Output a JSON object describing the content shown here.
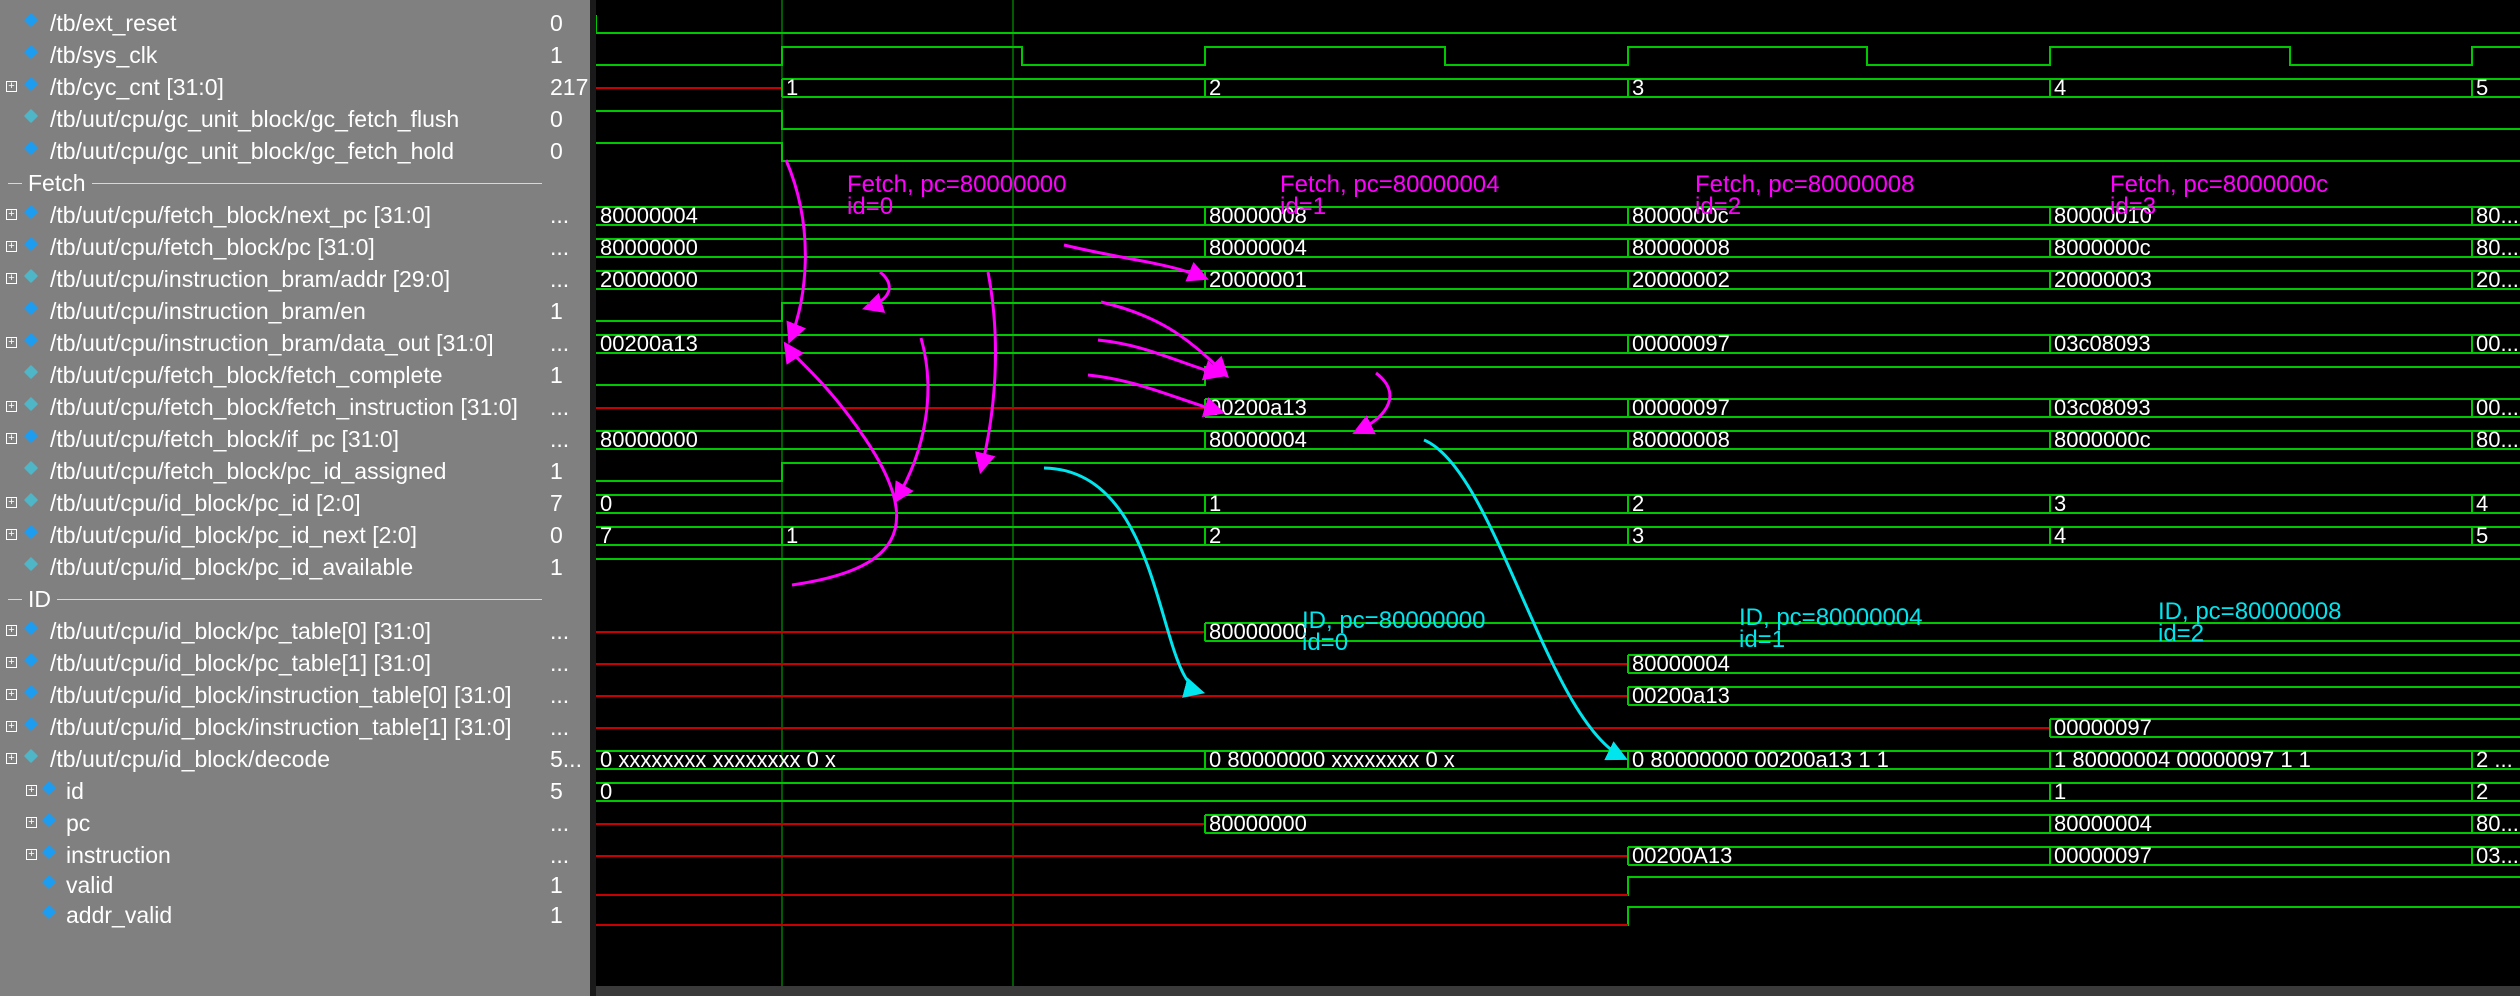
{
  "colors": {
    "trace": "#00c800",
    "undefined": "#c80000",
    "cursor": "#00b400",
    "fetch_note": "#ff00ff",
    "id_note": "#00e5ee",
    "value_text": "#ffffff"
  },
  "groups": {
    "fetch": "Fetch",
    "id": "ID"
  },
  "signals": [
    {
      "name": "/tb/ext_reset",
      "value": "0",
      "expandable": false,
      "child": false,
      "kind": "in"
    },
    {
      "name": "/tb/sys_clk",
      "value": "1",
      "expandable": false,
      "child": false,
      "kind": "in"
    },
    {
      "name": "/tb/cyc_cnt [31:0]",
      "value": "217",
      "expandable": true,
      "child": false,
      "kind": "in"
    },
    {
      "name": "/tb/uut/cpu/gc_unit_block/gc_fetch_flush",
      "value": "0",
      "expandable": false,
      "child": false,
      "kind": "out"
    },
    {
      "name": "/tb/uut/cpu/gc_unit_block/gc_fetch_hold",
      "value": "0",
      "expandable": false,
      "child": false,
      "kind": "in"
    },
    {
      "name": "/tb/uut/cpu/fetch_block/next_pc [31:0]",
      "value": "...",
      "expandable": true,
      "child": false,
      "kind": "in"
    },
    {
      "name": "/tb/uut/cpu/fetch_block/pc [31:0]",
      "value": "...",
      "expandable": true,
      "child": false,
      "kind": "in"
    },
    {
      "name": "/tb/uut/cpu/instruction_bram/addr [29:0]",
      "value": "...",
      "expandable": true,
      "child": false,
      "kind": "out"
    },
    {
      "name": "/tb/uut/cpu/instruction_bram/en",
      "value": "1",
      "expandable": false,
      "child": false,
      "kind": "in"
    },
    {
      "name": "/tb/uut/cpu/instruction_bram/data_out [31:0]",
      "value": "...",
      "expandable": true,
      "child": false,
      "kind": "in"
    },
    {
      "name": "/tb/uut/cpu/fetch_block/fetch_complete",
      "value": "1",
      "expandable": false,
      "child": false,
      "kind": "out"
    },
    {
      "name": "/tb/uut/cpu/fetch_block/fetch_instruction [31:0]",
      "value": "...",
      "expandable": true,
      "child": false,
      "kind": "out"
    },
    {
      "name": "/tb/uut/cpu/fetch_block/if_pc [31:0]",
      "value": "...",
      "expandable": true,
      "child": false,
      "kind": "in"
    },
    {
      "name": "/tb/uut/cpu/fetch_block/pc_id_assigned",
      "value": "1",
      "expandable": false,
      "child": false,
      "kind": "out"
    },
    {
      "name": "/tb/uut/cpu/id_block/pc_id [2:0]",
      "value": "7",
      "expandable": true,
      "child": false,
      "kind": "out"
    },
    {
      "name": "/tb/uut/cpu/id_block/pc_id_next [2:0]",
      "value": "0",
      "expandable": true,
      "child": false,
      "kind": "in"
    },
    {
      "name": "/tb/uut/cpu/id_block/pc_id_available",
      "value": "1",
      "expandable": false,
      "child": false,
      "kind": "out"
    },
    {
      "name": "/tb/uut/cpu/id_block/pc_table[0] [31:0]",
      "value": "...",
      "expandable": true,
      "child": false,
      "kind": "in"
    },
    {
      "name": "/tb/uut/cpu/id_block/pc_table[1] [31:0]",
      "value": "...",
      "expandable": true,
      "child": false,
      "kind": "in"
    },
    {
      "name": "/tb/uut/cpu/id_block/instruction_table[0] [31:0]",
      "value": "...",
      "expandable": true,
      "child": false,
      "kind": "in"
    },
    {
      "name": "/tb/uut/cpu/id_block/instruction_table[1] [31:0]",
      "value": "...",
      "expandable": true,
      "child": false,
      "kind": "in"
    },
    {
      "name": "/tb/uut/cpu/id_block/decode",
      "value": "5...",
      "expandable": true,
      "child": false,
      "kind": "out"
    },
    {
      "name": "id",
      "value": "5",
      "expandable": true,
      "child": true,
      "kind": "in"
    },
    {
      "name": "pc",
      "value": "...",
      "expandable": true,
      "child": true,
      "kind": "in"
    },
    {
      "name": "instruction",
      "value": "...",
      "expandable": true,
      "child": true,
      "kind": "in"
    },
    {
      "name": "valid",
      "value": "1",
      "expandable": false,
      "child": true,
      "kind": "in"
    },
    {
      "name": "addr_valid",
      "value": "1",
      "expandable": false,
      "child": true,
      "kind": "in"
    }
  ],
  "waves": {
    "cyc_cnt": [
      "1",
      "2",
      "3",
      "4",
      "5"
    ],
    "next_pc": [
      "80000004",
      "80000008",
      "8000000c",
      "80000010",
      "80..."
    ],
    "pc": [
      "80000000",
      "80000004",
      "80000008",
      "8000000c",
      "80..."
    ],
    "bram_addr": [
      "20000000",
      "20000001",
      "20000002",
      "20000003",
      "20..."
    ],
    "bram_data_out": [
      "00200a13",
      "00000097",
      "03c08093",
      "00..."
    ],
    "fetch_instruction": [
      "00200a13",
      "00000097",
      "03c08093",
      "00..."
    ],
    "if_pc": [
      "80000000",
      "80000004",
      "80000008",
      "8000000c",
      "80..."
    ],
    "pc_id": [
      "0",
      "1",
      "2",
      "3",
      "4"
    ],
    "pc_id_next": [
      "7",
      "1",
      "2",
      "3",
      "4",
      "5"
    ],
    "pc_table0": [
      "80000000"
    ],
    "pc_table1": [
      "80000004"
    ],
    "instruction_table0": [
      "00200a13"
    ],
    "instruction_table1": [
      "00000097"
    ],
    "decode": [
      "0 xxxxxxxx xxxxxxxx 0 x",
      "0 80000000 xxxxxxxx 0 x",
      "0 80000000 00200a13 1 1",
      "1 80000004 00000097 1 1",
      "2 ..."
    ],
    "decode_id": [
      "0",
      "1",
      "2"
    ],
    "decode_pc": [
      "80000000",
      "80000004",
      "80..."
    ],
    "decode_instruction": [
      "00200A13",
      "00000097",
      "03..."
    ]
  },
  "annotations": {
    "fetch": [
      {
        "line1": "Fetch, pc=80000000",
        "line2": "id=0"
      },
      {
        "line1": "Fetch, pc=80000004",
        "line2": "id=1"
      },
      {
        "line1": "Fetch, pc=80000008",
        "line2": "id=2"
      },
      {
        "line1": "Fetch, pc=8000000c",
        "line2": "id=3"
      }
    ],
    "id": [
      {
        "line1": "ID, pc=80000000",
        "line2": "id=0"
      },
      {
        "line1": "ID, pc=80000004",
        "line2": "id=1"
      },
      {
        "line1": "ID, pc=80000008",
        "line2": "id=2"
      }
    ]
  }
}
